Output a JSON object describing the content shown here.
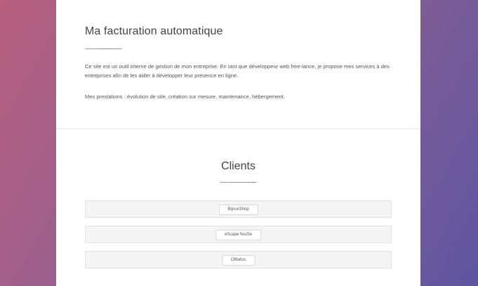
{
  "intro": {
    "title": "Ma facturation automatique",
    "paragraph_1": "Ce site est un outil interne de gestion de mon entreprise. En tant que développeur web free-lance, je propose mes services à des entreprises afin de les aider à développer leur présence en ligne.",
    "paragraph_2": "Mes prestations : évolution de site, création sur mesure, maintenance, hébergement."
  },
  "clients": {
    "title": "Clients",
    "items": [
      {
        "label": "BijouxShop"
      },
      {
        "label": "eScape houSe"
      },
      {
        "label": "OMatos"
      }
    ]
  },
  "colors": {
    "background_gradient": [
      "#b8607e",
      "#9a5f8e",
      "#7f5d96",
      "#5e55a0"
    ],
    "accent_gradient": [
      "#e08aa0",
      "#b07fc2",
      "#7c8fe0"
    ],
    "card_background": "#f4f4f4",
    "text": "#444444"
  }
}
